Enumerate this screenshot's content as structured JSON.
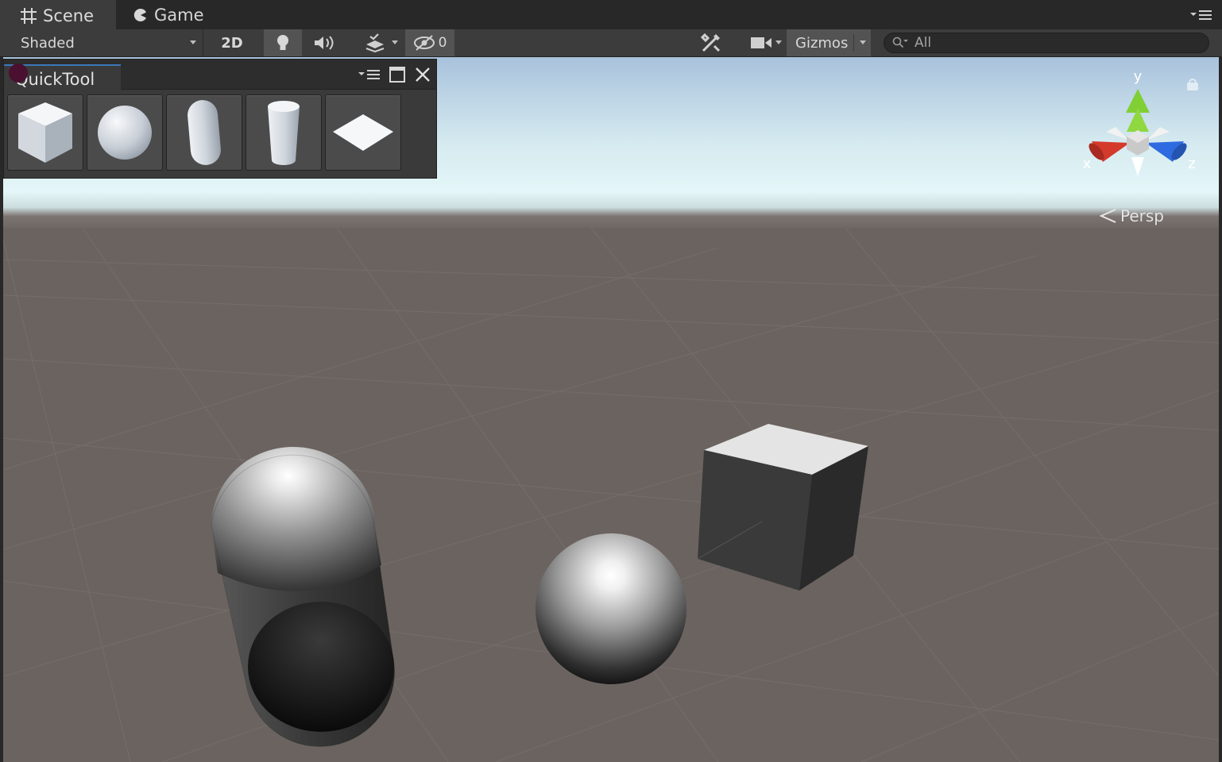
{
  "tabs": {
    "scene": "Scene",
    "game": "Game"
  },
  "toolbar": {
    "shading_mode": "Shaded",
    "mode_2d": "2D",
    "hidden_count": "0",
    "gizmos": "Gizmos",
    "search_placeholder": "All"
  },
  "quicktool": {
    "title": "QuickTool",
    "shapes": [
      "cube",
      "sphere",
      "capsule",
      "cylinder",
      "plane"
    ]
  },
  "scene": {
    "projection": "Persp",
    "axis_labels": {
      "y": "y",
      "x": "x",
      "z": "z"
    }
  },
  "colors": {
    "panel": "#3c3c3c",
    "tabbar": "#282828",
    "accent": "#3a79bb",
    "axis_x": "#d43a2c",
    "axis_y": "#7fcf35",
    "axis_z": "#2f6be0",
    "ground": "#6b6360",
    "sky_top": "#a9c3dd"
  }
}
